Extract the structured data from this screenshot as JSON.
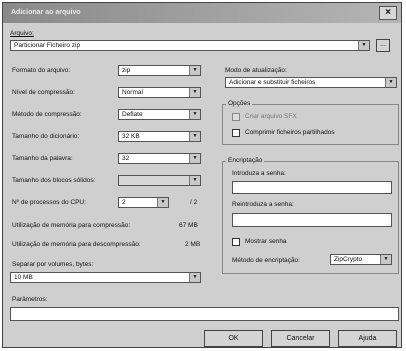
{
  "window": {
    "title": "Adicionar ao arquivo",
    "close_icon": "×"
  },
  "archive": {
    "label": "Arquivo:",
    "value": "Particionar Ficheiro zip",
    "browse_label": "..."
  },
  "left": {
    "format_label": "Formato do arquivo:",
    "format_value": "zip",
    "level_label": "Nível de compressão:",
    "level_value": "Normal",
    "method_label": "Método de compressão:",
    "method_value": "Deflate",
    "dict_label": "Tamanho do dicionário:",
    "dict_value": "32 KB",
    "word_label": "Tamanho da palavra:",
    "word_value": "32",
    "solid_label": "Tamanho dos blocos sólidos:",
    "solid_value": "",
    "threads_label": "Nº de processos do CPU:",
    "threads_value": "2",
    "threads_total": "/ 2",
    "mem_comp_label": "Utilização de memória para compressão:",
    "mem_comp_value": "67 MB",
    "mem_decomp_label": "Utilização de memória para descompressão:",
    "mem_decomp_value": "2 MB",
    "volume_label": "Separar por volumes, bytes:",
    "volume_value": "10 MB"
  },
  "right": {
    "update_label": "Modo de atualização:",
    "update_value": "Adicionar e substituir ficheiros",
    "options_title": "Opções",
    "sfx_label": "Criar arquivo SFX",
    "shared_label": "Comprimir ficheiros partilhados",
    "enc_title": "Encriptação",
    "pass_label": "Introduza a senha:",
    "repass_label": "Reintroduza a senha:",
    "show_pass_label": "Mostrar senha",
    "enc_method_label": "Método de encriptação:",
    "enc_method_value": "ZipCrypto"
  },
  "params": {
    "label": "Parâmetros:",
    "value": ""
  },
  "buttons": {
    "ok": "OK",
    "cancel": "Cancelar",
    "help": "Ajuda"
  },
  "icons": {
    "dropdown": "▼"
  }
}
